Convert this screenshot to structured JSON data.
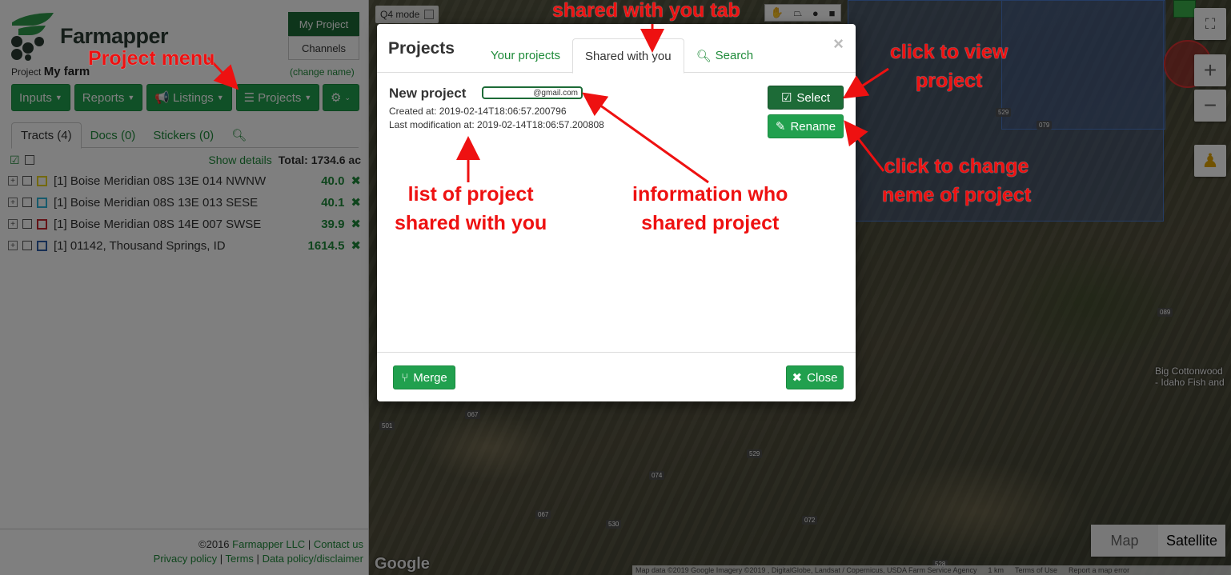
{
  "map": {
    "q4_mode_label": "Q4 mode",
    "road_labels": [
      "529",
      "079",
      "089",
      "067",
      "501",
      "529",
      "074",
      "067",
      "530",
      "072",
      "528"
    ],
    "place_name_line1": "Big Cottonwood",
    "place_name_line2": "- Idaho Fish and",
    "zoom_in": "+",
    "zoom_out": "−",
    "fullscreen_icon": "fullscreen-icon",
    "maptype_map": "Map",
    "maptype_satellite": "Satellite",
    "google_logo": "Google",
    "attribution": "Map data ©2019 Google Imagery ©2019 , DigitalGlobe, Landsat / Copernicus, USDA Farm Service Agency",
    "scale": "1 km",
    "terms": "Terms of Use",
    "report": "Report a map error"
  },
  "sidebar": {
    "brand": "Farmapper",
    "project_prefix": "Project",
    "project_name": "My farm",
    "change_name": "(change name)",
    "my_project": "My Project",
    "channels": "Channels",
    "buttons": [
      {
        "label": "Inputs",
        "icon": ""
      },
      {
        "label": "Reports",
        "icon": ""
      },
      {
        "label": "Listings",
        "icon": "bullhorn-icon"
      },
      {
        "label": "Projects",
        "icon": "list-icon"
      }
    ],
    "tabs": [
      "Tracts (4)",
      "Docs (0)",
      "Stickers (0)"
    ],
    "show_details": "Show details",
    "total": "Total: 1734.6 ac",
    "tracts": [
      {
        "name": "[1] Boise Meridian 08S 13E 014 NWNW",
        "area": "40.0",
        "color": "#e6d21e"
      },
      {
        "name": "[1] Boise Meridian 08S 13E 013 SESE",
        "area": "40.1",
        "color": "#2eb5d8"
      },
      {
        "name": "[1] Boise Meridian 08S 14E 007 SWSE",
        "area": "39.9",
        "color": "#c8242c"
      },
      {
        "name": "[1] 01142, Thousand Springs, ID",
        "area": "1614.5",
        "color": "#2f5fa8"
      }
    ],
    "footer": {
      "copyright": "©2016",
      "company": "Farmapper LLC",
      "sep": "|",
      "contact": "Contact us",
      "privacy": "Privacy policy",
      "terms": "Terms",
      "data_policy": "Data policy/disclaimer"
    }
  },
  "modal": {
    "title": "Projects",
    "tabs": [
      "Your projects",
      "Shared with you",
      "Search"
    ],
    "close_x": "×",
    "project": {
      "title": "New project",
      "shared_by": "@gmail.com",
      "created": "Created at: 2019-02-14T18:06:57.200796",
      "modified": "Last modification at: 2019-02-14T18:06:57.200808"
    },
    "select": "Select",
    "rename": "Rename",
    "merge": "Merge",
    "close": "Close"
  },
  "annotations": {
    "shared_tab": "shared with you tab",
    "project_menu": "Project menu",
    "view_line1": "click to view",
    "view_line2": "project",
    "change_line1": "click to change",
    "change_line2": "neme of project",
    "list_line1": "list of project",
    "list_line2": "shared with you",
    "info_line1": "information who",
    "info_line2": "shared project"
  }
}
